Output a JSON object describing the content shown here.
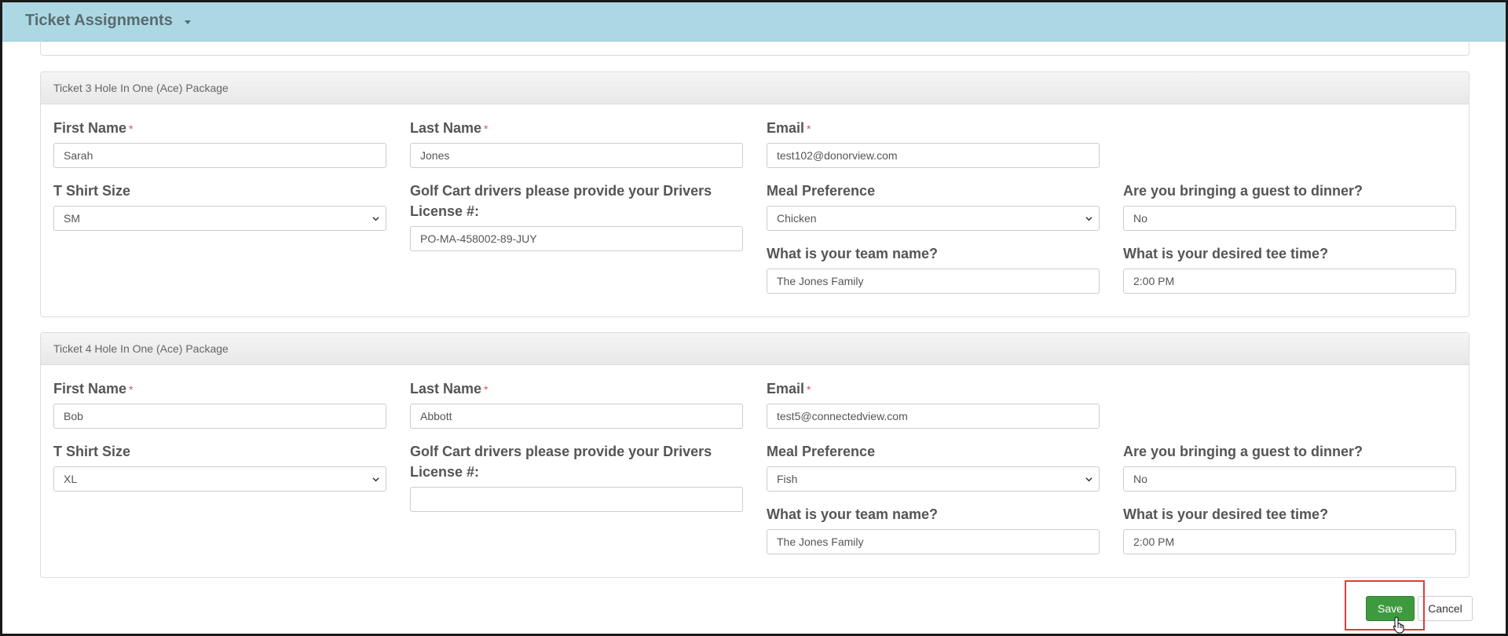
{
  "header": {
    "title": "Ticket Assignments"
  },
  "tickets": [
    {
      "heading": "Ticket 3 Hole In One (Ace) Package",
      "first_name": {
        "label": "First Name",
        "required": "*",
        "value": "Sarah"
      },
      "last_name": {
        "label": "Last Name",
        "required": "*",
        "value": "Jones"
      },
      "email": {
        "label": "Email",
        "required": "*",
        "value": "test102@donorview.com"
      },
      "tshirt": {
        "label": "T Shirt Size",
        "value": "SM"
      },
      "license": {
        "label_line1": "Golf Cart drivers please provide your Drivers",
        "label_line2": "License #:",
        "value": "PO-MA-458002-89-JUY"
      },
      "meal": {
        "label": "Meal Preference",
        "value": "Chicken"
      },
      "guest": {
        "label": "Are you bringing a guest to dinner?",
        "value": "No"
      },
      "team": {
        "label": "What is your team name?",
        "value": "The Jones Family"
      },
      "tee_time": {
        "label": "What is your desired tee time?",
        "value": "2:00 PM"
      }
    },
    {
      "heading": "Ticket 4 Hole In One (Ace) Package",
      "first_name": {
        "label": "First Name",
        "required": "*",
        "value": "Bob"
      },
      "last_name": {
        "label": "Last Name",
        "required": "*",
        "value": "Abbott"
      },
      "email": {
        "label": "Email",
        "required": "*",
        "value": "test5@connectedview.com"
      },
      "tshirt": {
        "label": "T Shirt Size",
        "value": "XL"
      },
      "license": {
        "label_line1": "Golf Cart drivers please provide your Drivers",
        "label_line2": "License #:",
        "value": ""
      },
      "meal": {
        "label": "Meal Preference",
        "value": "Fish"
      },
      "guest": {
        "label": "Are you bringing a guest to dinner?",
        "value": "No"
      },
      "team": {
        "label": "What is your team name?",
        "value": "The Jones Family"
      },
      "tee_time": {
        "label": "What is your desired tee time?",
        "value": "2:00 PM"
      }
    }
  ],
  "actions": {
    "save_label": "Save",
    "cancel_label": "Cancel"
  },
  "colors": {
    "header_bg": "#acd8e3",
    "save_bg": "#3e9a3e",
    "required": "#d9534f",
    "highlight": "#e03c3c"
  }
}
